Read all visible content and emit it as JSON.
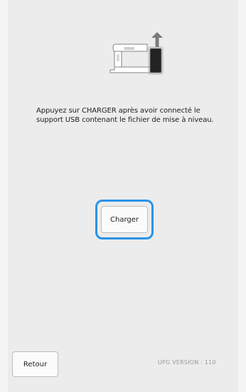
{
  "illustration": {
    "icon": "sewing-machine-usb-upload-icon"
  },
  "message": {
    "line1": "Appuyez sur CHARGER après avoir connecté le",
    "line2": "support USB contenant le fichier de mise à niveau."
  },
  "buttons": {
    "charger_label": "Charger",
    "retour_label": "Retour"
  },
  "footer": {
    "version_text": "UPG VERSION : 110"
  },
  "colors": {
    "highlight": "#2a93e8",
    "background": "#ececec"
  }
}
